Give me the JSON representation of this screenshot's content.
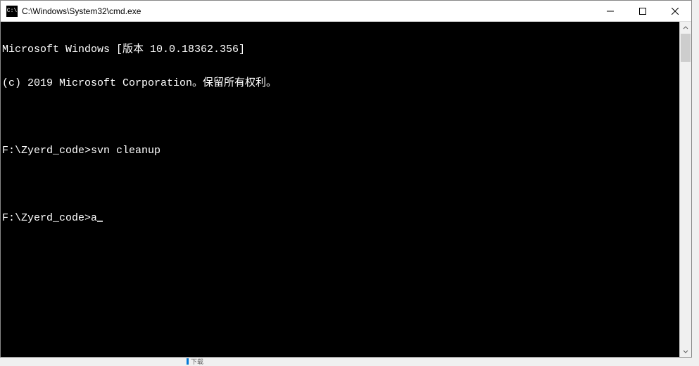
{
  "window": {
    "icon_text": "C:\\",
    "title": "C:\\Windows\\System32\\cmd.exe"
  },
  "terminal": {
    "lines": [
      "Microsoft Windows [版本 10.0.18362.356]",
      "(c) 2019 Microsoft Corporation。保留所有权利。",
      "",
      "F:\\Zyerd_code>svn cleanup",
      "",
      "F:\\Zyerd_code>a"
    ]
  },
  "taskbar": {
    "label": "下载"
  }
}
